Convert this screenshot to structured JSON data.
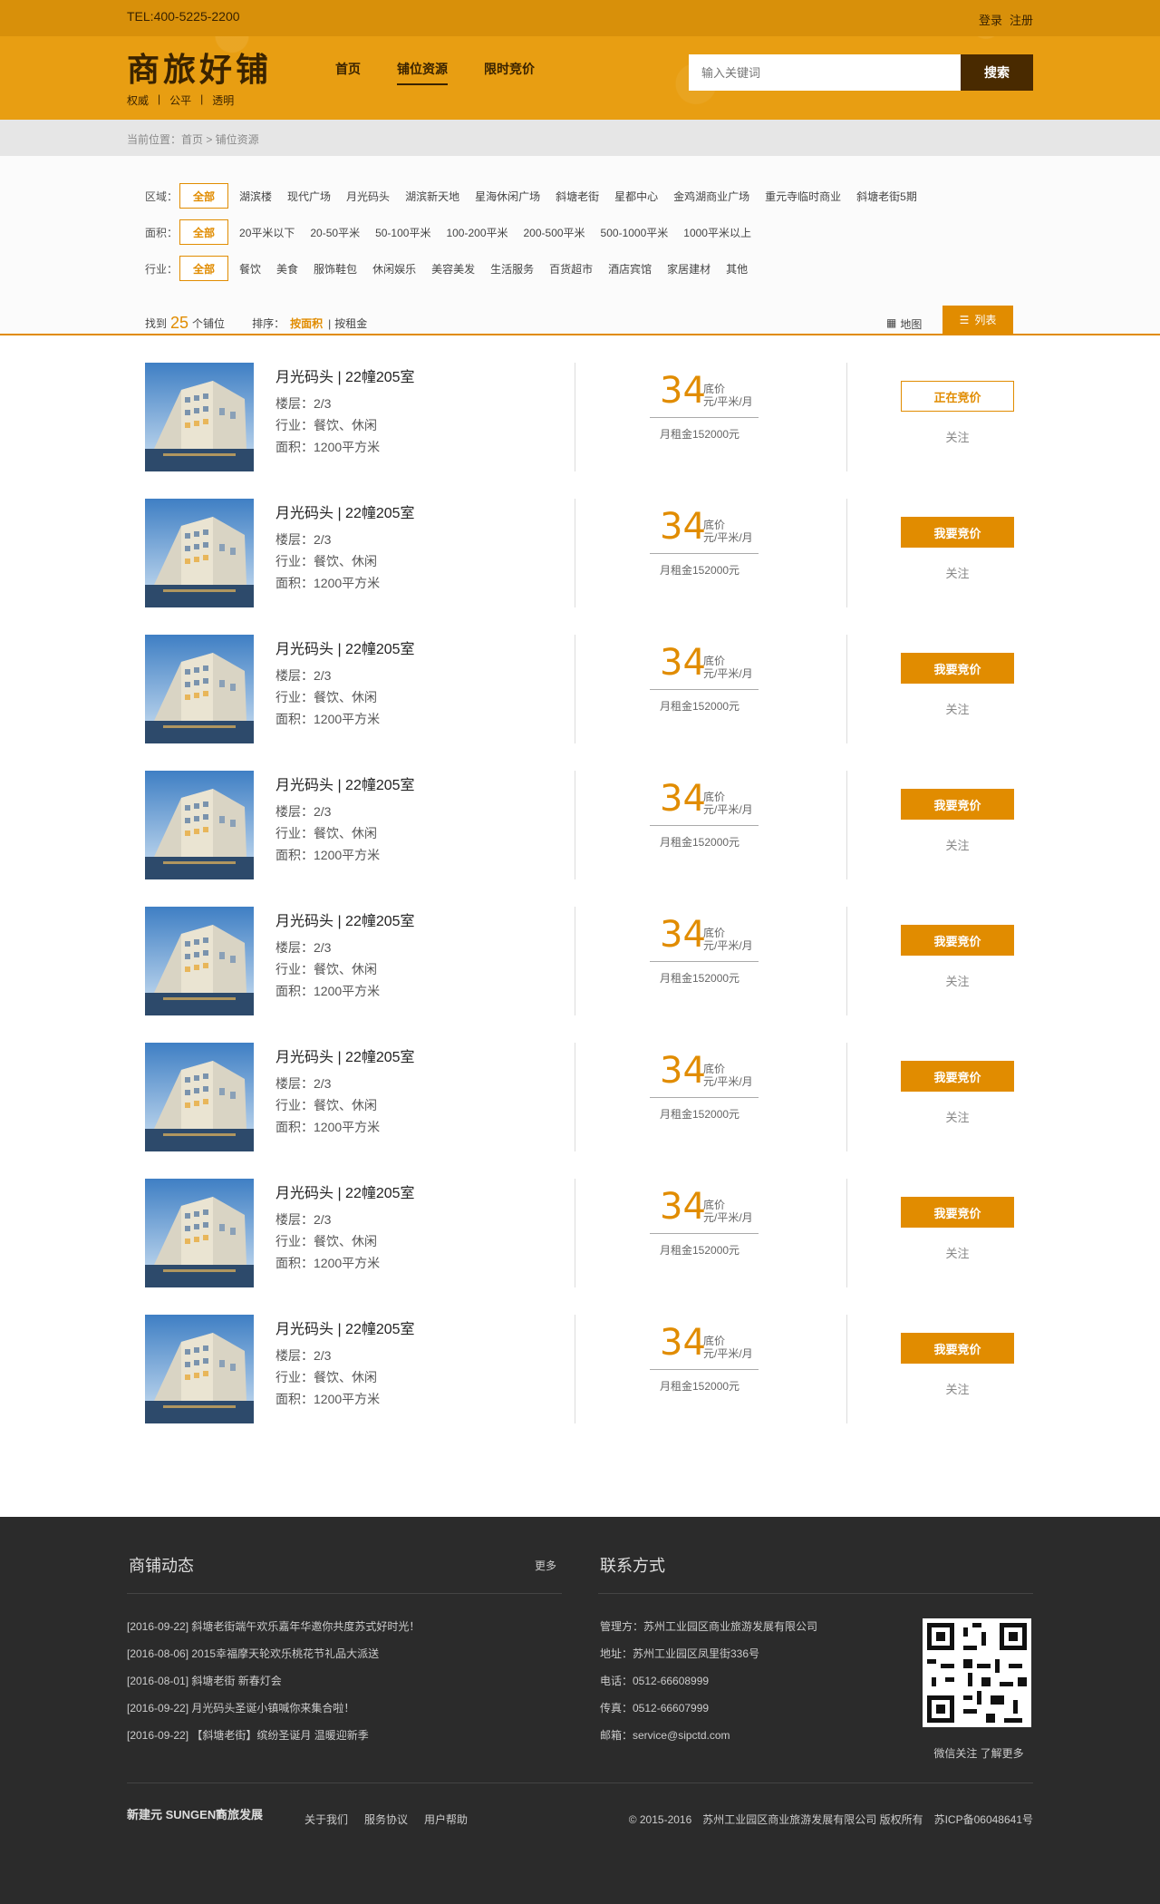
{
  "header": {
    "tel": "TEL:400-5225-2200",
    "login": "登录",
    "register": "注册",
    "logo_main": "商旅好铺",
    "logo_sub": [
      "权威",
      "|",
      "公平",
      "|",
      "透明"
    ],
    "nav": [
      "首页",
      "铺位资源",
      "限时竞价"
    ],
    "nav_active": 1,
    "search_placeholder": "输入关键词",
    "search_btn": "搜索",
    "brand_color": "#e18c00",
    "dark_color": "#492a00"
  },
  "breadcrumb": "当前位置：首页 > 铺位资源",
  "filters": {
    "rows": [
      {
        "label": "区域：",
        "all": "全部",
        "options": [
          "湖滨楼",
          "现代广场",
          "月光码头",
          "湖滨新天地",
          "星海休闲广场",
          "斜塘老街",
          "星都中心",
          "金鸡湖商业广场",
          "重元寺临时商业",
          "斜塘老街5期"
        ]
      },
      {
        "label": "面积：",
        "all": "全部",
        "options": [
          "20平米以下",
          "20-50平米",
          "50-100平米",
          "100-200平米",
          "200-500平米",
          "500-1000平米",
          "1000平米以上"
        ]
      },
      {
        "label": "行业：",
        "all": "全部",
        "options": [
          "餐饮",
          "美食",
          "服饰鞋包",
          "休闲娱乐",
          "美容美发",
          "生活服务",
          "百货超市",
          "酒店宾馆",
          "家居建材",
          "其他"
        ]
      }
    ],
    "results_prefix": "找到",
    "results_count": "25",
    "results_suffix": "个铺位",
    "sort_label": "排序：",
    "sort_area": "按面积",
    "sort_rent": "按租金",
    "view_map": "地图",
    "view_list": "列表"
  },
  "listings": [
    {
      "title": "月光码头 | 22幢205室",
      "floor": "楼层：2/3",
      "industry": "行业：餐饮、休闲",
      "area": "面积：1200平方米",
      "price": "34",
      "price_label": "底价",
      "unit": "元/平米/月",
      "rent": "月租金152000元",
      "button": "正在竞价",
      "follow": "关注"
    },
    {
      "title": "月光码头 | 22幢205室",
      "floor": "楼层：2/3",
      "industry": "行业：餐饮、休闲",
      "area": "面积：1200平方米",
      "price": "34",
      "price_label": "底价",
      "unit": "元/平米/月",
      "rent": "月租金152000元",
      "button": "我要竞价",
      "follow": "关注"
    },
    {
      "title": "月光码头 | 22幢205室",
      "floor": "楼层：2/3",
      "industry": "行业：餐饮、休闲",
      "area": "面积：1200平方米",
      "price": "34",
      "price_label": "底价",
      "unit": "元/平米/月",
      "rent": "月租金152000元",
      "button": "我要竞价",
      "follow": "关注"
    },
    {
      "title": "月光码头 | 22幢205室",
      "floor": "楼层：2/3",
      "industry": "行业：餐饮、休闲",
      "area": "面积：1200平方米",
      "price": "34",
      "price_label": "底价",
      "unit": "元/平米/月",
      "rent": "月租金152000元",
      "button": "我要竞价",
      "follow": "关注"
    },
    {
      "title": "月光码头 | 22幢205室",
      "floor": "楼层：2/3",
      "industry": "行业：餐饮、休闲",
      "area": "面积：1200平方米",
      "price": "34",
      "price_label": "底价",
      "unit": "元/平米/月",
      "rent": "月租金152000元",
      "button": "我要竞价",
      "follow": "关注"
    },
    {
      "title": "月光码头 | 22幢205室",
      "floor": "楼层：2/3",
      "industry": "行业：餐饮、休闲",
      "area": "面积：1200平方米",
      "price": "34",
      "price_label": "底价",
      "unit": "元/平米/月",
      "rent": "月租金152000元",
      "button": "我要竞价",
      "follow": "关注"
    },
    {
      "title": "月光码头 | 22幢205室",
      "floor": "楼层：2/3",
      "industry": "行业：餐饮、休闲",
      "area": "面积：1200平方米",
      "price": "34",
      "price_label": "底价",
      "unit": "元/平米/月",
      "rent": "月租金152000元",
      "button": "我要竞价",
      "follow": "关注"
    },
    {
      "title": "月光码头 | 22幢205室",
      "floor": "楼层：2/3",
      "industry": "行业：餐饮、休闲",
      "area": "面积：1200平方米",
      "price": "34",
      "price_label": "底价",
      "unit": "元/平米/月",
      "rent": "月租金152000元",
      "button": "我要竞价",
      "follow": "关注"
    }
  ],
  "footer": {
    "news_title": "商铺动态",
    "news_more": "更多",
    "news": [
      "[2016-09-22] 斜塘老街端午欢乐嘉年华邀你共度苏式好时光！",
      "[2016-08-06] 2015幸福摩天轮欢乐桃花节礼品大派送",
      "[2016-08-01] 斜塘老街 新春灯会",
      "[2016-09-22] 月光码头圣诞小镇喊你来集合啦！",
      "[2016-09-22] 【斜塘老街】缤纷圣诞月 温暖迎新季"
    ],
    "contact_title": "联系方式",
    "contact": [
      "管理方：苏州工业园区商业旅游发展有限公司",
      "地址：苏州工业园区凤里街336号",
      "电话：0512-66608999",
      "传真：0512-66607999",
      "邮箱：service@sipctd.com"
    ],
    "qr_caption": "微信关注 了解更多",
    "brand1": "新建元 SUNGENT",
    "brand2": "商旅发展",
    "links": [
      "关于我们",
      "服务协议",
      "用户帮助"
    ],
    "copyright": "© 2015-2016　苏州工业园区商业旅游发展有限公司 版权所有　苏ICP备06048641号"
  }
}
